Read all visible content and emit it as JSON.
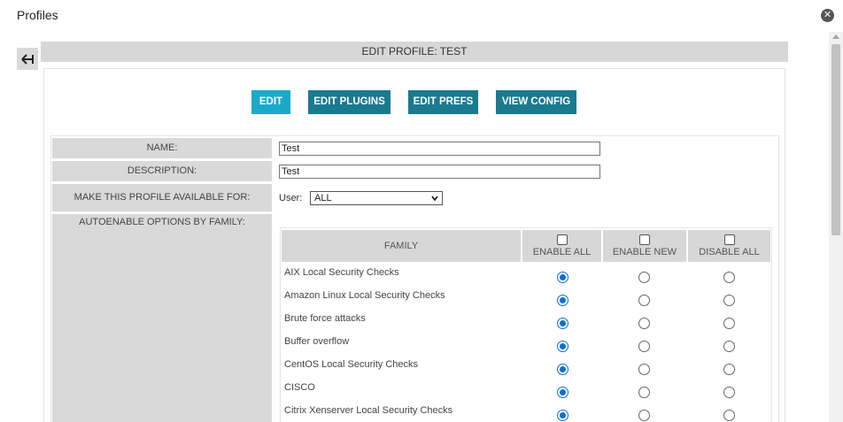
{
  "window": {
    "title": "Profiles",
    "close_icon": "close-icon"
  },
  "header": {
    "title": "EDIT PROFILE: TEST"
  },
  "tabs": [
    {
      "label": "EDIT",
      "active": true
    },
    {
      "label": "EDIT PLUGINS",
      "active": false
    },
    {
      "label": "EDIT PREFS",
      "active": false
    },
    {
      "label": "VIEW CONFIG",
      "active": false
    }
  ],
  "form": {
    "name_label": "NAME:",
    "name_value": "Test",
    "description_label": "DESCRIPTION:",
    "description_value": "Test",
    "availability_label": "MAKE THIS PROFILE AVAILABLE FOR:",
    "user_label": "User:",
    "user_selected": "ALL",
    "autoenable_label": "AUTOENABLE OPTIONS BY FAMILY:"
  },
  "families_table": {
    "columns": {
      "family": "FAMILY",
      "enable_all": "ENABLE ALL",
      "enable_new": "ENABLE NEW",
      "disable_all": "DISABLE ALL"
    },
    "rows": [
      {
        "family": "AIX Local Security Checks",
        "selected": "enable_all"
      },
      {
        "family": "Amazon Linux Local Security Checks",
        "selected": "enable_all"
      },
      {
        "family": "Brute force attacks",
        "selected": "enable_all"
      },
      {
        "family": "Buffer overflow",
        "selected": "enable_all"
      },
      {
        "family": "CentOS Local Security Checks",
        "selected": "enable_all"
      },
      {
        "family": "CISCO",
        "selected": "enable_all"
      },
      {
        "family": "Citrix Xenserver Local Security Checks",
        "selected": "enable_all"
      }
    ]
  },
  "colors": {
    "tab_active": "#1ca9c9",
    "tab_inactive": "#1b7a8e",
    "radio_checked": "#0b6fd6",
    "label_bg": "#d9d9d9"
  }
}
